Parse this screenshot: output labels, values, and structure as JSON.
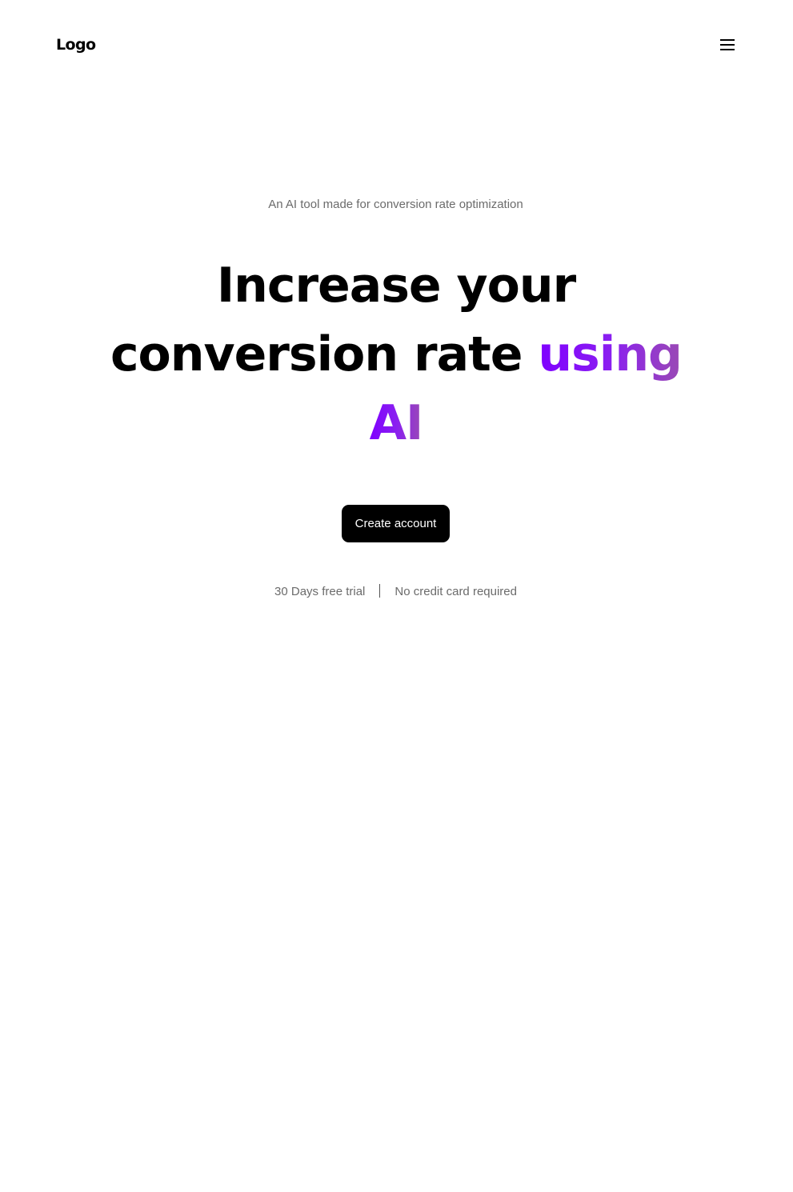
{
  "nav": {
    "logo_text": "Logo",
    "menu_icon": "hamburger-menu-icon"
  },
  "hero": {
    "eyebrow": "An AI tool made for conversion rate optimization",
    "headline": {
      "line1": "Increase your",
      "line2_plain": "conversion rate ",
      "line2_accent": "using",
      "line3_accent": "AI"
    },
    "cta_label": "Create account",
    "perks": [
      "30 Days free trial",
      "No credit card required"
    ]
  },
  "colors": {
    "accent_start": "#7f00ff",
    "accent_end": "#9a4ab4",
    "cta_background": "#000000",
    "muted_text": "#6b6b6b"
  }
}
